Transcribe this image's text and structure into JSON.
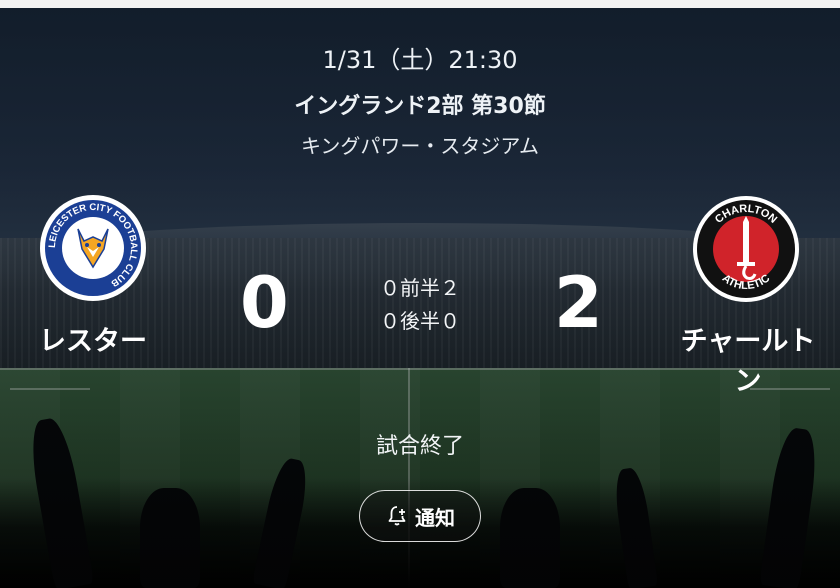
{
  "match": {
    "datetime": "1/31（土）21:30",
    "competition": "イングランド2部 第30節",
    "stadium": "キングパワー・スタジアム",
    "status": "試合終了"
  },
  "home": {
    "name": "レスター",
    "score": "0",
    "crest_text": "LEICESTER CITY FOOTBALL CLUB",
    "crest_colors": {
      "ring": "#1b3f95",
      "accent": "#f5a623"
    }
  },
  "away": {
    "name": "チャールトン",
    "score": "2",
    "crest_text_top": "CHARLTON",
    "crest_text_bottom": "ATHLETIC",
    "crest_colors": {
      "ring": "#111111",
      "inner": "#d0232a"
    }
  },
  "halves": {
    "first": "０前半２",
    "second": "０後半０"
  },
  "actions": {
    "notify_label": "通知",
    "notify_icon": "bell-plus-icon"
  }
}
